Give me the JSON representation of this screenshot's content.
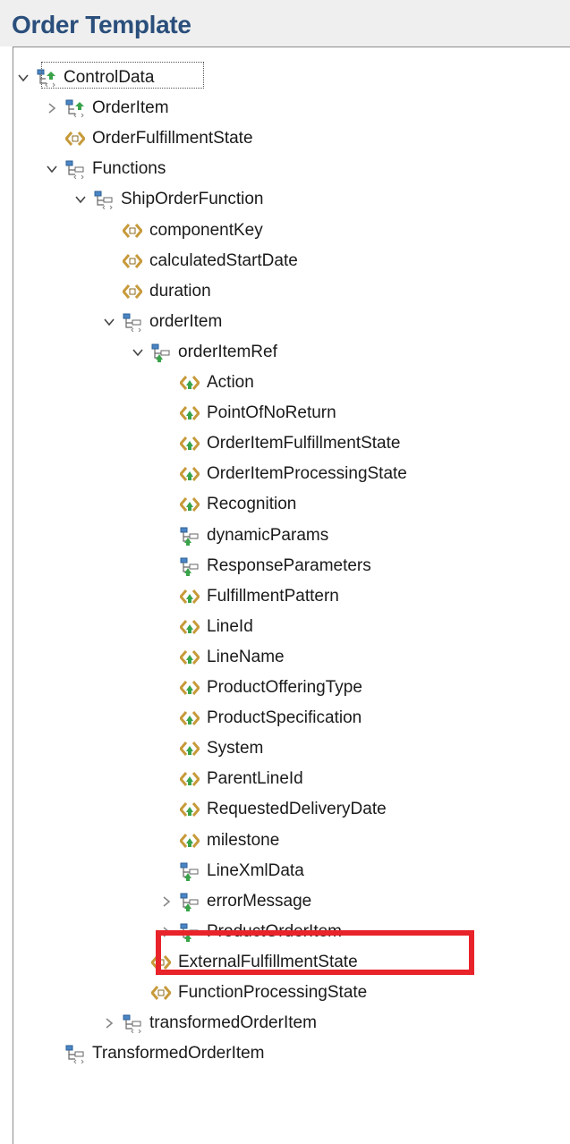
{
  "header": {
    "title": "Order Template"
  },
  "tree": [
    {
      "label": "ControlData",
      "depth": 0,
      "expand": "expanded",
      "icon": "structure-in-icon"
    },
    {
      "label": "OrderItem",
      "depth": 1,
      "expand": "collapsed",
      "icon": "structure-in-icon"
    },
    {
      "label": "OrderFulfillmentState",
      "depth": 1,
      "expand": "none",
      "icon": "data-element-icon"
    },
    {
      "label": "Functions",
      "depth": 1,
      "expand": "expanded",
      "icon": "structure-icon"
    },
    {
      "label": "ShipOrderFunction",
      "depth": 2,
      "expand": "expanded",
      "icon": "structure-icon"
    },
    {
      "label": "componentKey",
      "depth": 3,
      "expand": "none",
      "icon": "data-element-icon"
    },
    {
      "label": "calculatedStartDate",
      "depth": 3,
      "expand": "none",
      "icon": "data-element-icon"
    },
    {
      "label": "duration",
      "depth": 3,
      "expand": "none",
      "icon": "data-element-icon"
    },
    {
      "label": "orderItem",
      "depth": 3,
      "expand": "expanded",
      "icon": "structure-icon"
    },
    {
      "label": "orderItemRef",
      "depth": 4,
      "expand": "expanded",
      "icon": "structure-ref-icon"
    },
    {
      "label": "Action",
      "depth": 5,
      "expand": "none",
      "icon": "data-element-ref-icon"
    },
    {
      "label": "PointOfNoReturn",
      "depth": 5,
      "expand": "none",
      "icon": "data-element-ref-icon"
    },
    {
      "label": "OrderItemFulfillmentState",
      "depth": 5,
      "expand": "none",
      "icon": "data-element-ref-icon"
    },
    {
      "label": "OrderItemProcessingState",
      "depth": 5,
      "expand": "none",
      "icon": "data-element-ref-icon"
    },
    {
      "label": "Recognition",
      "depth": 5,
      "expand": "none",
      "icon": "data-element-ref-icon"
    },
    {
      "label": "dynamicParams",
      "depth": 5,
      "expand": "none",
      "icon": "structure-ref-icon"
    },
    {
      "label": "ResponseParameters",
      "depth": 5,
      "expand": "none",
      "icon": "structure-ref-icon"
    },
    {
      "label": "FulfillmentPattern",
      "depth": 5,
      "expand": "none",
      "icon": "data-element-ref-icon"
    },
    {
      "label": "LineId",
      "depth": 5,
      "expand": "none",
      "icon": "data-element-ref-icon"
    },
    {
      "label": "LineName",
      "depth": 5,
      "expand": "none",
      "icon": "data-element-ref-icon"
    },
    {
      "label": "ProductOfferingType",
      "depth": 5,
      "expand": "none",
      "icon": "data-element-ref-icon"
    },
    {
      "label": "ProductSpecification",
      "depth": 5,
      "expand": "none",
      "icon": "data-element-ref-icon"
    },
    {
      "label": "System",
      "depth": 5,
      "expand": "none",
      "icon": "data-element-ref-icon"
    },
    {
      "label": "ParentLineId",
      "depth": 5,
      "expand": "none",
      "icon": "data-element-ref-icon"
    },
    {
      "label": "RequestedDeliveryDate",
      "depth": 5,
      "expand": "none",
      "icon": "data-element-ref-icon"
    },
    {
      "label": "milestone",
      "depth": 5,
      "expand": "none",
      "icon": "data-element-ref-icon"
    },
    {
      "label": "LineXmlData",
      "depth": 5,
      "expand": "none",
      "icon": "structure-ref-icon"
    },
    {
      "label": "errorMessage",
      "depth": 5,
      "expand": "collapsed",
      "icon": "structure-ref-icon"
    },
    {
      "label": "ProductOrderItem",
      "depth": 5,
      "expand": "collapsed",
      "icon": "structure-ref-icon"
    },
    {
      "label": "ExternalFulfillmentState",
      "depth": 4,
      "expand": "none",
      "icon": "data-element-icon"
    },
    {
      "label": "FunctionProcessingState",
      "depth": 4,
      "expand": "none",
      "icon": "data-element-icon"
    },
    {
      "label": "transformedOrderItem",
      "depth": 3,
      "expand": "collapsed",
      "icon": "structure-icon"
    },
    {
      "label": "TransformedOrderItem",
      "depth": 1,
      "expand": "none",
      "icon": "structure-icon"
    }
  ],
  "colors": {
    "title": "#2b4f7c",
    "highlight": "#e8232a",
    "element_icon": "#c79a3a",
    "ref_icon": "#3aa34a",
    "structure_icon": "#4a86c5"
  }
}
